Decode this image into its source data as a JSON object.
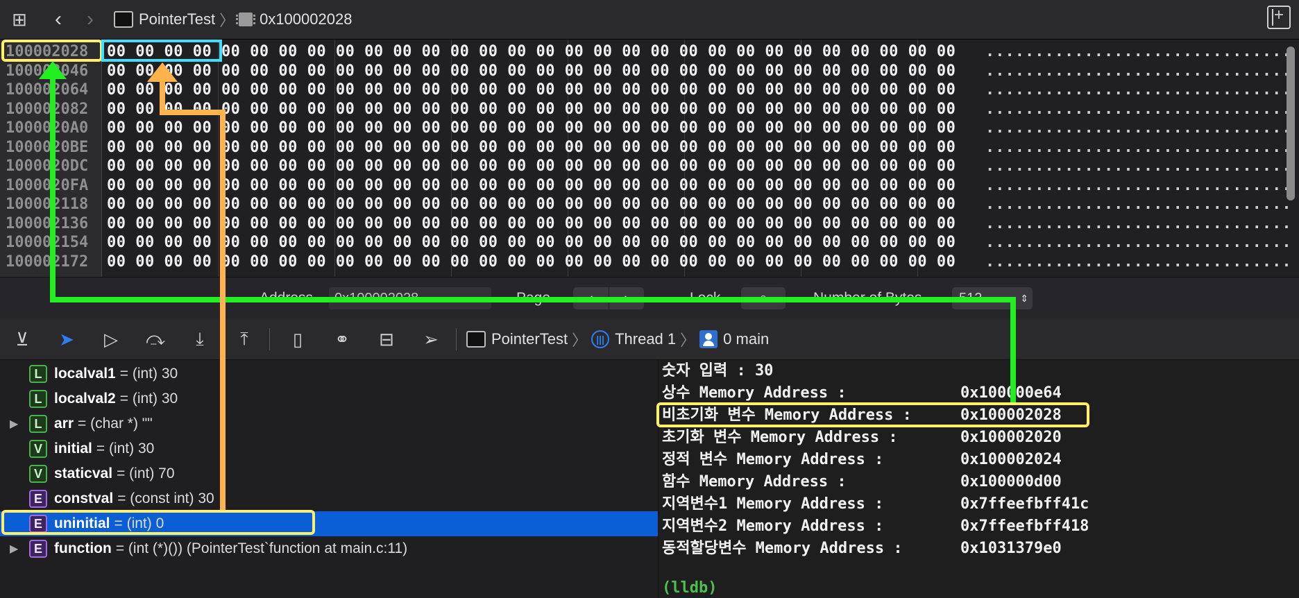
{
  "nav": {
    "project": "PointerTest",
    "location": "0x100002028"
  },
  "memory": {
    "rows": [
      {
        "addr": "100002028",
        "bytes": "00 00 00 00 00 00 00 00 00 00 00 00 00 00 00 00 00 00 00 00 00 00 00 00 00 00 00 00 00 00",
        "ascii": "..............................."
      },
      {
        "addr": "100002046",
        "bytes": "00 00 00 00 00 00 00 00 00 00 00 00 00 00 00 00 00 00 00 00 00 00 00 00 00 00 00 00 00 00",
        "ascii": "..............................."
      },
      {
        "addr": "100002064",
        "bytes": "00 00 00 00 00 00 00 00 00 00 00 00 00 00 00 00 00 00 00 00 00 00 00 00 00 00 00 00 00 00",
        "ascii": "..............................."
      },
      {
        "addr": "100002082",
        "bytes": "00 00 00 00 00 00 00 00 00 00 00 00 00 00 00 00 00 00 00 00 00 00 00 00 00 00 00 00 00 00",
        "ascii": "..............................."
      },
      {
        "addr": "1000020A0",
        "bytes": "00 00 00 00 00 00 00 00 00 00 00 00 00 00 00 00 00 00 00 00 00 00 00 00 00 00 00 00 00 00",
        "ascii": "..............................."
      },
      {
        "addr": "1000020BE",
        "bytes": "00 00 00 00 00 00 00 00 00 00 00 00 00 00 00 00 00 00 00 00 00 00 00 00 00 00 00 00 00 00",
        "ascii": "..............................."
      },
      {
        "addr": "1000020DC",
        "bytes": "00 00 00 00 00 00 00 00 00 00 00 00 00 00 00 00 00 00 00 00 00 00 00 00 00 00 00 00 00 00",
        "ascii": "..............................."
      },
      {
        "addr": "1000020FA",
        "bytes": "00 00 00 00 00 00 00 00 00 00 00 00 00 00 00 00 00 00 00 00 00 00 00 00 00 00 00 00 00 00",
        "ascii": "..............................."
      },
      {
        "addr": "100002118",
        "bytes": "00 00 00 00 00 00 00 00 00 00 00 00 00 00 00 00 00 00 00 00 00 00 00 00 00 00 00 00 00 00",
        "ascii": "..............................."
      },
      {
        "addr": "100002136",
        "bytes": "00 00 00 00 00 00 00 00 00 00 00 00 00 00 00 00 00 00 00 00 00 00 00 00 00 00 00 00 00 00",
        "ascii": "..............................."
      },
      {
        "addr": "100002154",
        "bytes": "00 00 00 00 00 00 00 00 00 00 00 00 00 00 00 00 00 00 00 00 00 00 00 00 00 00 00 00 00 00",
        "ascii": "..............................."
      },
      {
        "addr": "100002172",
        "bytes": "00 00 00 00 00 00 00 00 00 00 00 00 00 00 00 00 00 00 00 00 00 00 00 00 00 00 00 00 00 00",
        "ascii": "..............................."
      }
    ]
  },
  "memctrl": {
    "address_label": "Address",
    "address_value": "0x100002028",
    "page_label": "Page",
    "lock_label": "Lock",
    "bytes_label": "Number of Bytes",
    "bytes_value": "512"
  },
  "debugbar": {
    "project": "PointerTest",
    "thread": "Thread 1",
    "frame": "0 main"
  },
  "variables": [
    {
      "kind": "L",
      "name": "localval1",
      "value": "= (int) 30",
      "expandable": false,
      "selected": false
    },
    {
      "kind": "L",
      "name": "localval2",
      "value": "= (int) 30",
      "expandable": false,
      "selected": false
    },
    {
      "kind": "L",
      "name": "arr",
      "value": "= (char *) \"\"",
      "expandable": true,
      "selected": false
    },
    {
      "kind": "V",
      "name": "initial",
      "value": "= (int) 30",
      "expandable": false,
      "selected": false
    },
    {
      "kind": "V",
      "name": "staticval",
      "value": "= (int) 70",
      "expandable": false,
      "selected": false
    },
    {
      "kind": "E",
      "name": "constval",
      "value": "= (const int) 30",
      "expandable": false,
      "selected": false
    },
    {
      "kind": "E",
      "name": "uninitial",
      "value": "= (int) 0",
      "expandable": false,
      "selected": true
    },
    {
      "kind": "E",
      "name": "function",
      "value": "= (int (*)()) (PointerTest`function at main.c:11)",
      "expandable": true,
      "selected": false
    }
  ],
  "console": {
    "lines": [
      {
        "label": "숫자 입력 : 30",
        "value": ""
      },
      {
        "label": "상수 Memory Address :",
        "value": "0x100000e64"
      },
      {
        "label": "비초기화 변수 Memory Address :",
        "value": "0x100002028"
      },
      {
        "label": "초기화 변수 Memory Address :",
        "value": "0x100002020"
      },
      {
        "label": "정적 변수 Memory Address :",
        "value": "0x100002024"
      },
      {
        "label": "함수 Memory Address :",
        "value": "0x100000d00"
      },
      {
        "label": "지역변수1 Memory Address :",
        "value": "0x7ffeefbff41c"
      },
      {
        "label": "지역변수2 Memory Address :",
        "value": "0x7ffeefbff418"
      },
      {
        "label": "동적할당변수 Memory Address :",
        "value": "0x1031379e0"
      }
    ],
    "prompt": "(lldb)"
  },
  "colors": {
    "highlight_yellow": "#fff06a",
    "highlight_cyan": "#3fe0ff",
    "arrow_green": "#22ee22",
    "arrow_orange": "#ffb34d",
    "selection_blue": "#0b5fd6"
  }
}
